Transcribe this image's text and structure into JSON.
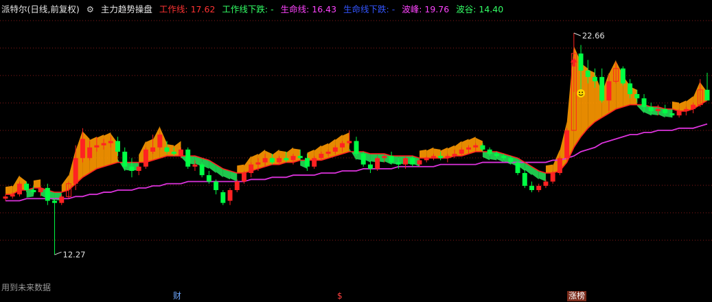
{
  "header": {
    "stock": "派特尔(日线,前复权)",
    "indicator": "主力趋势操盘",
    "work_line": "工作线: 17.62",
    "work_line_down": "工作线下跌: -",
    "life_line": "生命线: 16.43",
    "life_line_down": "生命线下跌: -",
    "peak": "波峰: 19.76",
    "trough": "波谷: 14.40",
    "gear_icon": "gear-icon"
  },
  "colors": {
    "background": "#000000",
    "grid": "#8b1a1a",
    "candle_up": "#ff2222",
    "candle_down": "#00ff44",
    "work_line": "#ff2020",
    "life_line": "#dd33dd",
    "band_up": "#ff9900",
    "band_down": "#22dd55",
    "stock_title": "#e6e6e6",
    "indicator_title": "#e6e6e6",
    "work_line_text": "#ff3333",
    "work_line_down_text": "#33ff66",
    "life_line_text": "#ff44ff",
    "life_line_down_text": "#3355ff",
    "peak_text": "#ff44ff",
    "trough_text": "#33ff66"
  },
  "chart_data": {
    "type": "candlestick",
    "ylim": [
      10.7,
      23.5
    ],
    "max_label": "22.66",
    "min_label": "12.27",
    "max_value": 22.66,
    "min_value": 12.27,
    "candles": [
      [
        14.9,
        15.1,
        14.8,
        15.0
      ],
      [
        15.0,
        15.2,
        14.9,
        15.1
      ],
      [
        15.1,
        15.7,
        15.0,
        15.6
      ],
      [
        15.6,
        15.7,
        15.2,
        15.3
      ],
      [
        15.3,
        15.5,
        15.1,
        15.2
      ],
      [
        15.2,
        15.5,
        15.0,
        15.4
      ],
      [
        15.4,
        15.6,
        14.6,
        14.8
      ],
      [
        14.8,
        14.9,
        12.27,
        14.7
      ],
      [
        14.7,
        15.1,
        14.6,
        15.0
      ],
      [
        15.0,
        15.7,
        14.9,
        15.6
      ],
      [
        15.6,
        17.4,
        15.3,
        16.8
      ],
      [
        16.8,
        18.2,
        16.6,
        17.7
      ],
      [
        16.8,
        17.6,
        16.7,
        17.3
      ],
      [
        17.3,
        17.8,
        17.1,
        17.4
      ],
      [
        17.4,
        17.7,
        17.2,
        17.5
      ],
      [
        17.5,
        17.8,
        17.3,
        17.6
      ],
      [
        17.6,
        17.8,
        16.9,
        17.1
      ],
      [
        17.1,
        17.3,
        16.2,
        16.4
      ],
      [
        16.4,
        16.8,
        15.9,
        16.2
      ],
      [
        16.2,
        16.6,
        16.0,
        16.4
      ],
      [
        16.4,
        17.3,
        16.3,
        17.2
      ],
      [
        17.1,
        17.9,
        17.0,
        17.3
      ],
      [
        17.3,
        18.0,
        17.2,
        17.9
      ],
      [
        17.3,
        17.6,
        17.0,
        17.1
      ],
      [
        17.1,
        17.3,
        16.9,
        17.0
      ],
      [
        16.9,
        17.3,
        16.8,
        17.2
      ],
      [
        17.2,
        17.3,
        16.3,
        16.4
      ],
      [
        16.4,
        16.7,
        16.2,
        16.5
      ],
      [
        16.5,
        16.6,
        15.9,
        16.0
      ],
      [
        16.0,
        16.2,
        15.6,
        15.7
      ],
      [
        15.7,
        15.8,
        15.1,
        15.3
      ],
      [
        15.2,
        15.3,
        14.6,
        14.7
      ],
      [
        14.8,
        15.4,
        14.6,
        15.3
      ],
      [
        15.3,
        15.8,
        15.2,
        15.7
      ],
      [
        15.7,
        16.2,
        15.6,
        16.1
      ],
      [
        16.1,
        16.6,
        15.9,
        16.5
      ],
      [
        16.5,
        16.8,
        16.2,
        16.6
      ],
      [
        16.6,
        17.0,
        16.4,
        16.8
      ],
      [
        16.8,
        17.0,
        16.5,
        16.6
      ],
      [
        16.6,
        16.9,
        16.5,
        16.8
      ],
      [
        16.8,
        17.1,
        16.6,
        16.7
      ],
      [
        16.7,
        17.0,
        16.5,
        16.9
      ],
      [
        16.9,
        17.2,
        16.7,
        16.8
      ],
      [
        16.8,
        17.0,
        16.2,
        16.4
      ],
      [
        16.4,
        16.9,
        16.3,
        16.8
      ],
      [
        16.8,
        17.1,
        16.7,
        17.0
      ],
      [
        17.0,
        17.2,
        16.9,
        17.1
      ],
      [
        17.1,
        17.4,
        17.0,
        17.3
      ],
      [
        17.3,
        17.6,
        17.1,
        17.5
      ],
      [
        17.5,
        18.1,
        17.4,
        17.6
      ],
      [
        17.6,
        17.8,
        16.9,
        17.0
      ],
      [
        17.0,
        17.1,
        16.4,
        16.5
      ],
      [
        16.5,
        16.7,
        16.1,
        16.3
      ],
      [
        16.3,
        16.9,
        16.2,
        16.8
      ],
      [
        16.8,
        17.0,
        16.6,
        16.9
      ],
      [
        16.9,
        17.1,
        16.5,
        16.6
      ],
      [
        16.6,
        16.8,
        16.3,
        16.5
      ],
      [
        16.5,
        16.9,
        16.3,
        16.8
      ],
      [
        16.8,
        16.9,
        16.4,
        16.5
      ],
      [
        16.5,
        16.8,
        16.4,
        16.7
      ],
      [
        16.7,
        16.9,
        16.6,
        16.8
      ],
      [
        16.8,
        17.0,
        16.7,
        16.9
      ],
      [
        16.9,
        17.1,
        16.7,
        16.8
      ],
      [
        16.8,
        17.0,
        16.6,
        16.9
      ],
      [
        16.9,
        17.2,
        16.8,
        17.0
      ],
      [
        17.0,
        17.3,
        16.9,
        17.2
      ],
      [
        17.2,
        17.4,
        17.0,
        17.3
      ],
      [
        17.3,
        17.5,
        17.1,
        17.4
      ],
      [
        17.4,
        17.5,
        17.1,
        17.2
      ],
      [
        17.2,
        17.3,
        16.9,
        17.0
      ],
      [
        17.0,
        17.1,
        16.8,
        16.9
      ],
      [
        16.9,
        17.0,
        16.7,
        16.8
      ],
      [
        16.8,
        16.9,
        16.5,
        16.6
      ],
      [
        16.6,
        16.7,
        16.0,
        16.1
      ],
      [
        16.1,
        16.3,
        15.4,
        15.5
      ],
      [
        15.5,
        15.7,
        15.2,
        15.3
      ],
      [
        15.3,
        15.6,
        15.2,
        15.5
      ],
      [
        15.5,
        15.8,
        15.4,
        15.7
      ],
      [
        15.7,
        16.2,
        15.6,
        16.1
      ],
      [
        16.1,
        16.9,
        16.0,
        16.8
      ],
      [
        16.8,
        18.2,
        16.7,
        18.1
      ],
      [
        18.1,
        22.66,
        19.9,
        21.7
      ],
      [
        21.7,
        22.1,
        19.9,
        20.9
      ],
      [
        20.9,
        21.4,
        20.3,
        20.6
      ],
      [
        20.6,
        21.0,
        20.1,
        20.4
      ],
      [
        20.6,
        21.0,
        19.4,
        19.5
      ],
      [
        19.5,
        20.7,
        19.0,
        20.4
      ],
      [
        20.4,
        21.3,
        20.3,
        21.0
      ],
      [
        21.0,
        21.1,
        20.2,
        20.3
      ],
      [
        20.3,
        20.5,
        19.6,
        19.8
      ],
      [
        19.8,
        20.0,
        19.4,
        19.6
      ],
      [
        19.6,
        19.8,
        19.0,
        19.2
      ],
      [
        19.2,
        19.4,
        18.8,
        19.0
      ],
      [
        19.0,
        19.3,
        18.8,
        19.1
      ],
      [
        19.1,
        19.3,
        18.8,
        18.9
      ],
      [
        18.9,
        19.1,
        18.7,
        18.8
      ],
      [
        18.8,
        19.1,
        18.7,
        19.0
      ],
      [
        19.0,
        19.2,
        18.8,
        19.1
      ],
      [
        19.1,
        19.4,
        18.9,
        19.3
      ],
      [
        19.3,
        20.5,
        19.2,
        20.0
      ],
      [
        20.0,
        20.8,
        19.6,
        19.5
      ]
    ],
    "work_line": [
      15.1,
      15.1,
      15.3,
      15.3,
      15.4,
      15.4,
      15.3,
      15.2,
      15.2,
      15.3,
      15.6,
      15.9,
      16.1,
      16.3,
      16.4,
      16.5,
      16.6,
      16.6,
      16.6,
      16.6,
      16.6,
      16.7,
      16.8,
      16.9,
      16.9,
      16.9,
      16.9,
      16.9,
      16.8,
      16.7,
      16.5,
      16.3,
      16.2,
      16.1,
      16.1,
      16.2,
      16.3,
      16.4,
      16.5,
      16.5,
      16.6,
      16.6,
      16.7,
      16.7,
      16.7,
      16.7,
      16.8,
      16.9,
      17.0,
      17.1,
      17.1,
      17.1,
      17.0,
      17.0,
      17.0,
      16.9,
      16.9,
      16.9,
      16.9,
      16.8,
      16.8,
      16.8,
      16.8,
      16.8,
      16.9,
      16.9,
      17.0,
      17.1,
      17.1,
      17.1,
      17.1,
      17.0,
      16.9,
      16.8,
      16.6,
      16.4,
      16.2,
      16.1,
      16.1,
      16.2,
      16.6,
      17.3,
      17.8,
      18.2,
      18.5,
      18.7,
      18.9,
      19.1,
      19.2,
      19.3,
      19.3,
      19.3,
      19.2,
      19.2,
      19.1,
      19.1,
      19.0,
      19.0,
      19.1,
      19.3,
      19.5
    ],
    "life_line": [
      14.8,
      14.8,
      14.8,
      14.9,
      14.9,
      14.9,
      14.9,
      14.9,
      14.9,
      14.9,
      15.0,
      15.0,
      15.1,
      15.1,
      15.2,
      15.2,
      15.3,
      15.3,
      15.3,
      15.4,
      15.4,
      15.5,
      15.5,
      15.6,
      15.6,
      15.6,
      15.7,
      15.7,
      15.7,
      15.7,
      15.7,
      15.7,
      15.7,
      15.7,
      15.7,
      15.8,
      15.8,
      15.8,
      15.9,
      15.9,
      15.9,
      16.0,
      16.0,
      16.0,
      16.0,
      16.1,
      16.1,
      16.1,
      16.2,
      16.2,
      16.2,
      16.3,
      16.3,
      16.3,
      16.3,
      16.3,
      16.4,
      16.4,
      16.4,
      16.4,
      16.4,
      16.4,
      16.5,
      16.5,
      16.5,
      16.5,
      16.5,
      16.5,
      16.6,
      16.6,
      16.6,
      16.6,
      16.6,
      16.6,
      16.6,
      16.6,
      16.6,
      16.6,
      16.7,
      16.7,
      16.8,
      16.9,
      17.1,
      17.2,
      17.3,
      17.5,
      17.6,
      17.7,
      17.8,
      17.9,
      17.9,
      18.0,
      18.0,
      18.1,
      18.1,
      18.1,
      18.2,
      18.2,
      18.2,
      18.3,
      18.4
    ],
    "markers": [
      {
        "index": 81,
        "kind": "red-arrow-icon"
      },
      {
        "index": 82,
        "kind": "smiley-icon"
      }
    ]
  },
  "footer": {
    "note": "用到未来数据",
    "mark_cai": "财",
    "mark_dollar": "$",
    "mark_zhangbang": "涨榜"
  }
}
